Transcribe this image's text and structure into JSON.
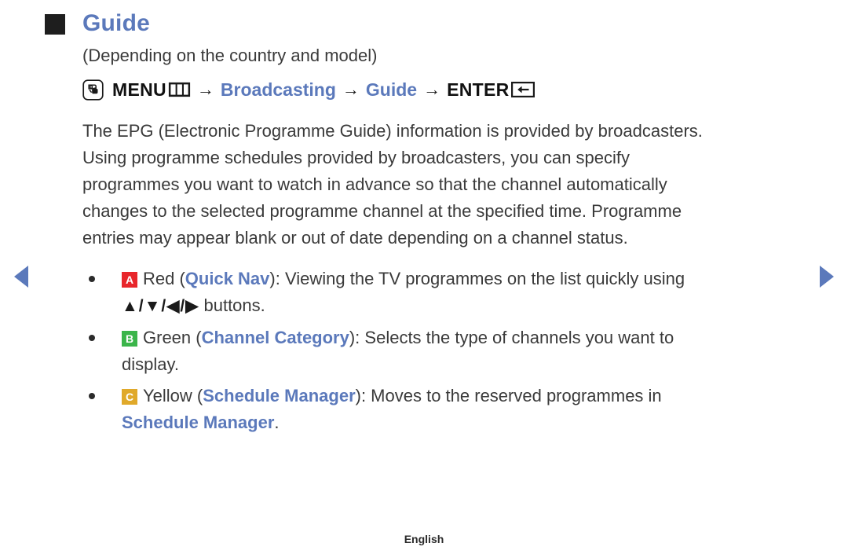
{
  "nav": {
    "prev_label": "Previous page",
    "next_label": "Next page",
    "prev_icon": "triangle-left-icon",
    "next_icon": "triangle-right-icon",
    "arrow_color": "#5b79bb"
  },
  "header": {
    "marker_icon": "black-square-bullet-icon",
    "title": "Guide",
    "title_color": "#5b79bb",
    "subtitle": "(Depending on the country and model)"
  },
  "menu_path": {
    "icon": "hand-press-menu-icon",
    "items": [
      {
        "label": "MENU",
        "style": "bold-black",
        "glyph": "menu-bars-key-icon"
      },
      {
        "label": "Broadcasting",
        "style": "blue"
      },
      {
        "label": "Guide",
        "style": "blue"
      },
      {
        "label": "ENTER",
        "style": "bold-black",
        "glyph": "enter-return-key-icon"
      }
    ],
    "separator": "→"
  },
  "body": {
    "lines": [
      "The EPG (Electronic Programme Guide) information is provided by broadcasters.",
      "Using programme schedules provided by broadcasters, you can specify",
      "programmes you want to watch in advance so that the channel automatically",
      "changes to the selected programme channel at the specified time. Programme",
      "entries may appear blank or out of date depending on a channel status."
    ]
  },
  "bullets": [
    {
      "badge": "A",
      "badge_color": "#e8262b",
      "badge_name": "red-button-badge",
      "line1_pre": "Red (",
      "line1_hl": "Quick Nav",
      "line1_post": "): Viewing the TV programmes on the list quickly using",
      "line2_arrows": "▲/▼/◀/▶",
      "line2_post": " buttons."
    },
    {
      "badge": "B",
      "badge_color": "#3bb54a",
      "badge_name": "green-button-badge",
      "line1_pre": "Green (",
      "line1_hl": "Channel Category",
      "line1_post": "): Selects the type of channels you want to",
      "line2_plain": "display."
    },
    {
      "badge": "C",
      "badge_color": "#e0a92a",
      "badge_name": "yellow-button-badge",
      "line1_pre": "Yellow (",
      "line1_hl": "Schedule Manager",
      "line1_post": "): Moves to the reserved programmes in",
      "line2_hl": "Schedule Manager",
      "line2_post": "."
    }
  ],
  "footer": {
    "language": "English"
  }
}
